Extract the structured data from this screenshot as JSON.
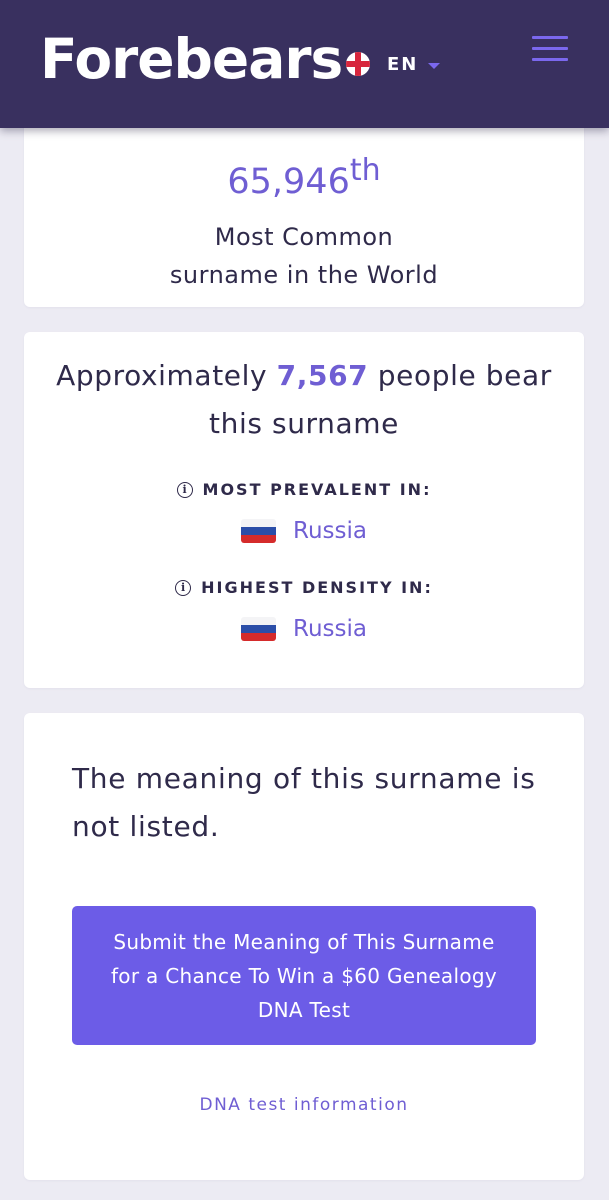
{
  "header": {
    "logo": "Forebears",
    "language": "EN",
    "language_flag_icon": "england-flag-icon",
    "menu_icon": "hamburger-menu-icon"
  },
  "rank": {
    "number": "65,946",
    "suffix": "th",
    "label_line1": "Most Common",
    "label_line2": "surname in the World"
  },
  "count": {
    "prefix": "Approximately",
    "number": "7,567",
    "suffix": "people bear this surname",
    "most_prevalent_heading": "MOST PREVALENT IN:",
    "most_prevalent_country": "Russia",
    "highest_density_heading": "HIGHEST DENSITY IN:",
    "highest_density_country": "Russia",
    "info_icon": "i"
  },
  "meaning": {
    "text": "The meaning of this surname is not listed.",
    "submit_button": "Submit the Meaning of This Surname for a Chance To Win a $60 Genealogy DNA Test",
    "dna_link": "DNA test information"
  },
  "colors": {
    "header_bg": "#39305f",
    "accent": "#6f5ed3",
    "button_bg": "#6c5ce7",
    "page_bg": "#ecebf3"
  }
}
